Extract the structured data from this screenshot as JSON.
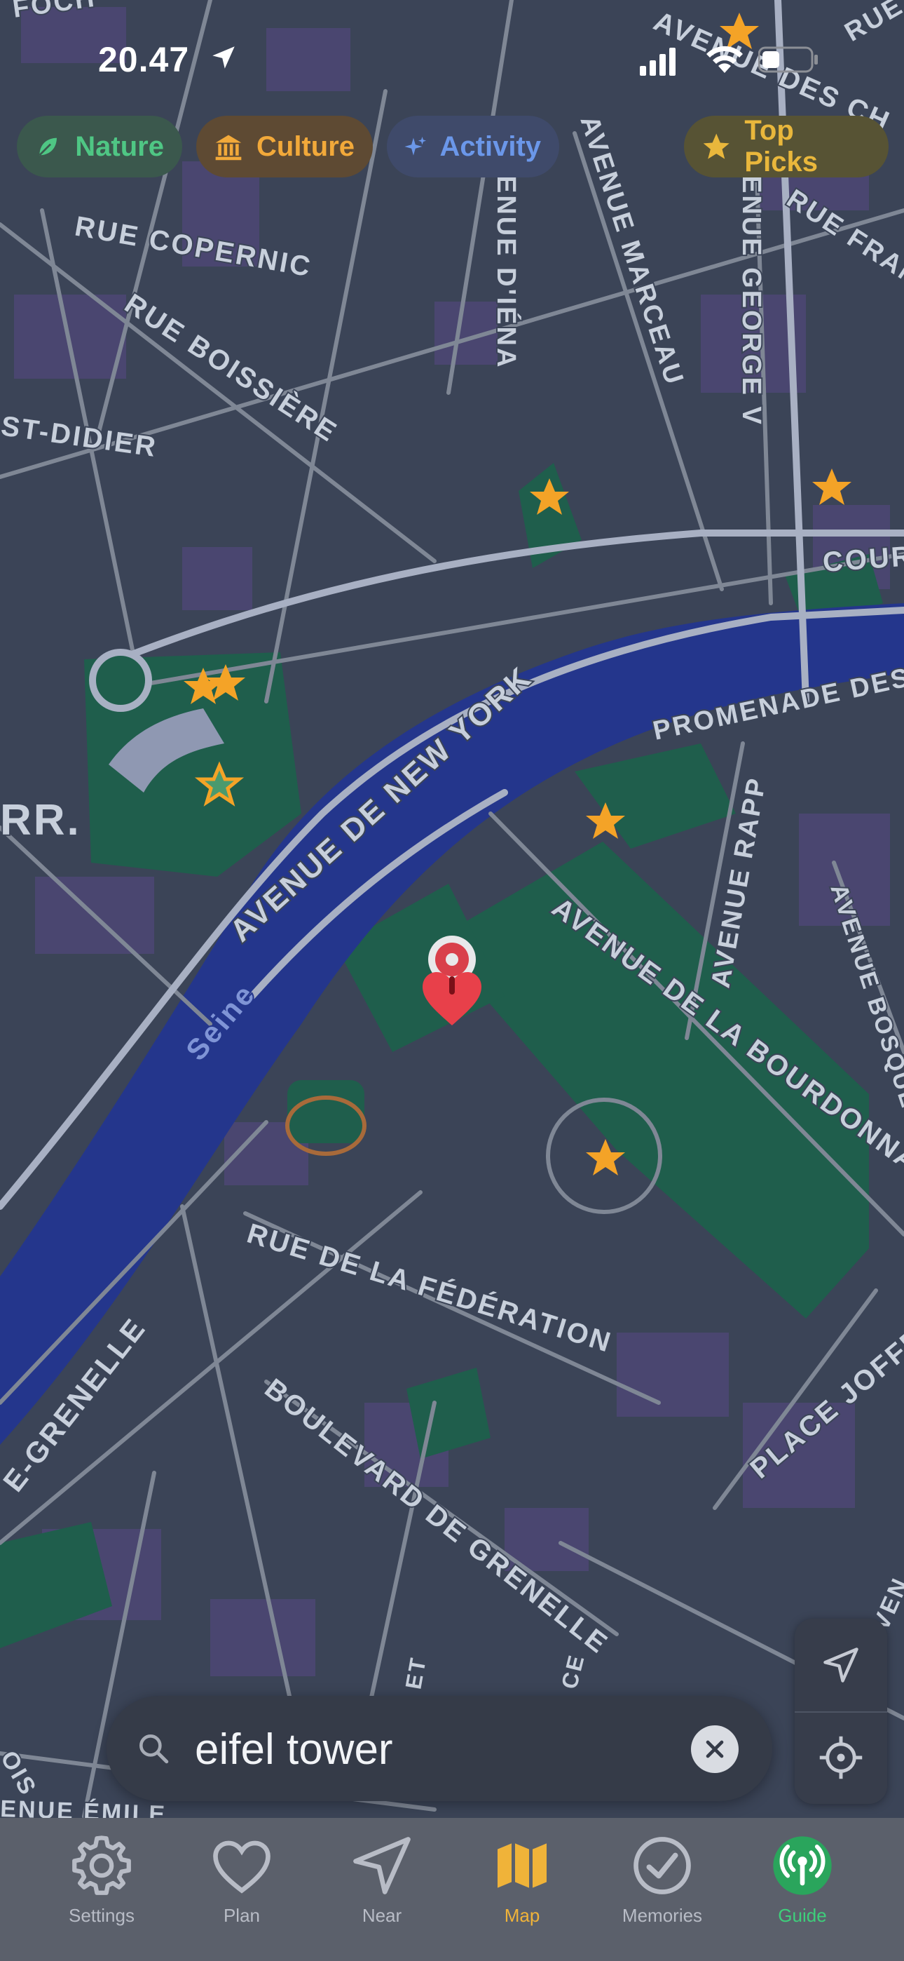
{
  "status_bar": {
    "time": "20.47"
  },
  "categories": [
    {
      "label": "Nature",
      "icon": "leaf-icon",
      "color": "#4fc684"
    },
    {
      "label": "Culture",
      "icon": "museum-icon",
      "color": "#f2a93a"
    },
    {
      "label": "Activity",
      "icon": "sparkle-icon",
      "color": "#6b97e9"
    },
    {
      "label": "Top Picks",
      "icon": "star-icon",
      "color": "#e9b73c"
    }
  ],
  "map": {
    "street_labels": [
      "AVENUE DES CH",
      "RUE COPERNIC",
      "RUE BOISSIÈRE",
      "ST-DIDIER",
      "ENUE D'IÉNA",
      "AVENUE MARCEAU",
      "ENUE GEORGE V",
      "RUE FRANÇ",
      "COUR",
      "PROMENADE DES",
      "AVENUE DE NEW YORK",
      "AVENUE RAPP",
      "AVENUE BOSQUET",
      "AVENUE DE LA BOURDONNAIS",
      "RUE DE LA FÉDÉRATION",
      "PLACE JOFFRE",
      "E-GRENELLE",
      "BOULEVARD DE GRENELLE",
      "RR.",
      "ENUE ÉMILE",
      "FOCH",
      "RUE",
      "AVEN",
      "ET",
      "CE",
      "OIS"
    ],
    "river_name": "Seine",
    "accent_colors": {
      "star": "#f4a327",
      "pin": "#e8404a",
      "river": "#24368c",
      "park": "#1c5e4a"
    }
  },
  "search": {
    "value": "eifel tower",
    "placeholder": "Search"
  },
  "tabs": [
    {
      "label": "Settings",
      "icon": "gear-icon"
    },
    {
      "label": "Plan",
      "icon": "heart-icon"
    },
    {
      "label": "Near",
      "icon": "navigation-arrow-icon"
    },
    {
      "label": "Map",
      "icon": "map-icon",
      "active": true
    },
    {
      "label": "Memories",
      "icon": "checkmark-circle-icon"
    },
    {
      "label": "Guide",
      "icon": "broadcast-icon"
    }
  ]
}
